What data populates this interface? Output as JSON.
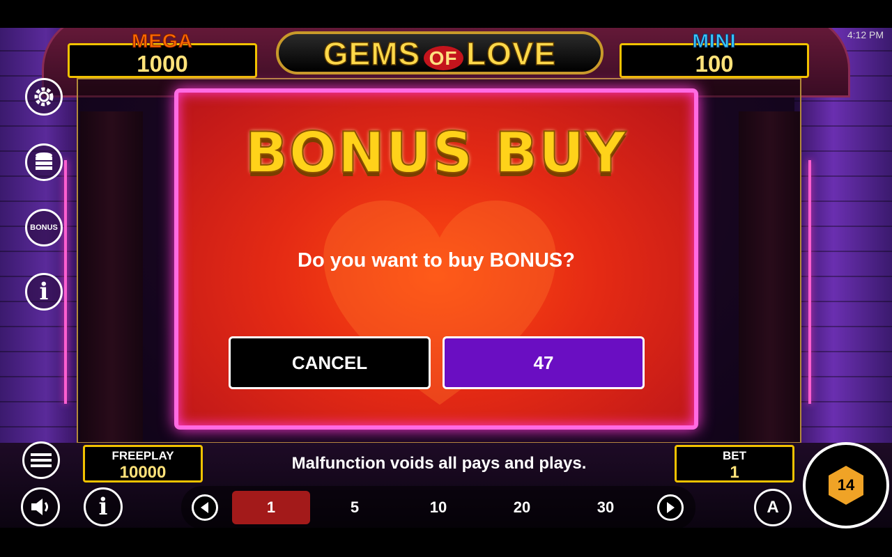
{
  "status_bar": {
    "time": "4:12 PM"
  },
  "jackpots": {
    "mega": {
      "label": "MEGA",
      "value": "1000"
    },
    "mini": {
      "label": "MINI",
      "value": "100"
    }
  },
  "logo": {
    "gems": "GEMS",
    "of": "OF",
    "love": "LOVE"
  },
  "side_menu": {
    "bonus_label": "BONUS",
    "info_glyph": "i"
  },
  "modal": {
    "title": "BONUS BUY",
    "question": "Do you want to buy BONUS?",
    "cancel_label": "CANCEL",
    "buy_label": "47"
  },
  "footer": {
    "freeplay": {
      "label": "FREEPLAY",
      "value": "10000"
    },
    "notice": "Malfunction voids all pays and plays.",
    "bet": {
      "label": "BET",
      "value": "1"
    },
    "bet_options": [
      "1",
      "5",
      "10",
      "20",
      "30"
    ],
    "selected_bet": "1",
    "info_glyph": "i",
    "auto_glyph": "A",
    "spin_glyph": "14"
  },
  "colors": {
    "modal_border": "#ff6be2",
    "cancel_bg": "#000000",
    "buy_bg": "#6a0ec2",
    "jackpot_border": "#f2c200",
    "selected_bet_bg": "#a31a1a"
  }
}
